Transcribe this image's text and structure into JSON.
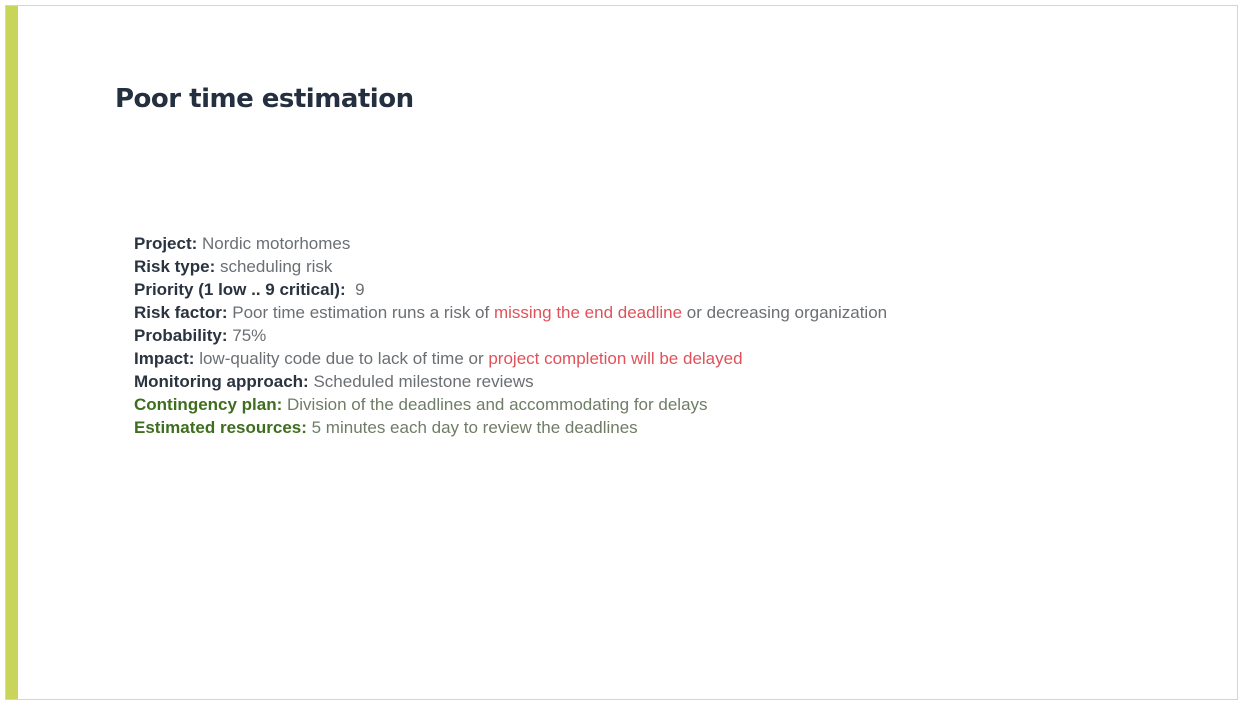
{
  "colors": {
    "accent_bar": "#c9d45a",
    "highlight": "#e0525a",
    "green_label": "#3f6e1f"
  },
  "title": "Poor time estimation",
  "fields": [
    {
      "label": "Project:",
      "parts": [
        {
          "t": " Nordic motorhomes"
        }
      ]
    },
    {
      "label": "Risk type:",
      "parts": [
        {
          "t": " scheduling risk"
        }
      ]
    },
    {
      "label": "Priority (1 low .. 9 critical):",
      "parts": [
        {
          "t": "  9"
        }
      ]
    },
    {
      "label": "Risk factor:",
      "parts": [
        {
          "t": " Poor time estimation runs a risk of "
        },
        {
          "t": "missing the end deadline",
          "red": true
        },
        {
          "t": " or decreasing organization"
        }
      ]
    },
    {
      "label": "Probability:",
      "parts": [
        {
          "t": " 75%"
        }
      ]
    },
    {
      "label": "Impact:",
      "parts": [
        {
          "t": " low-quality code due to lack of time or "
        },
        {
          "t": "project completion will be delayed",
          "red": true
        }
      ]
    },
    {
      "label": "Monitoring approach:",
      "parts": [
        {
          "t": " Scheduled milestone reviews"
        }
      ]
    },
    {
      "label": "Contingency plan:",
      "green": true,
      "parts": [
        {
          "t": " Division of the deadlines and accommodating for delays"
        }
      ]
    },
    {
      "label": "Estimated resources:",
      "green": true,
      "parts": [
        {
          "t": " 5 minutes each day to review the deadlines"
        }
      ]
    }
  ]
}
